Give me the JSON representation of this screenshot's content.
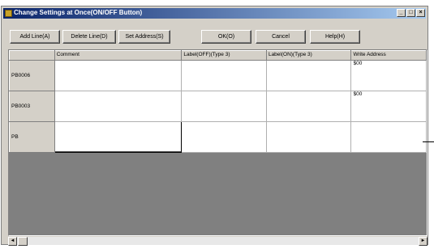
{
  "window": {
    "title": "Change Settings at Once(ON/OFF Button)"
  },
  "titlebar_buttons": [
    "_",
    "□",
    "×"
  ],
  "toolbar": {
    "add_line": "Add Line(A)",
    "delete_line": "Delete Line(D)",
    "set_address": "Set Address(S)",
    "ok": "OK(O)",
    "cancel": "Cancel",
    "help": "Help(H)"
  },
  "grid": {
    "columns": [
      "Comment",
      "Label(OFF)(Type 3)",
      "Label(ON)(Type 3)",
      "Write Address"
    ],
    "rows": [
      {
        "header": "PB0006",
        "comment": "",
        "label_off": "",
        "label_on": "",
        "write_address": "$00"
      },
      {
        "header": "PB0003",
        "comment": "",
        "label_off": "",
        "label_on": "",
        "write_address": "$00"
      },
      {
        "header": "PB",
        "comment": "",
        "label_off": "",
        "label_on": "",
        "write_address": ""
      }
    ]
  },
  "scrollbar": {
    "left_arrow": "◄",
    "right_arrow": "►"
  }
}
